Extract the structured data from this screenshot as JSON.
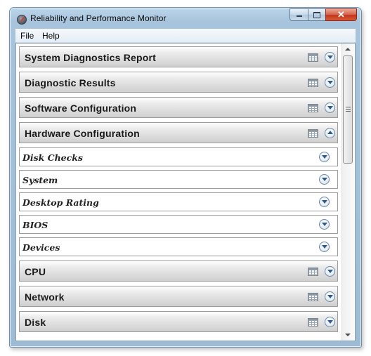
{
  "window": {
    "title": "Reliability and Performance Monitor",
    "close_glyph": "✕"
  },
  "menu": {
    "file": "File",
    "help": "Help"
  },
  "rows": [
    {
      "label": "System Diagnostics Report",
      "kind": "section",
      "expanded": false
    },
    {
      "label": "Diagnostic Results",
      "kind": "section",
      "expanded": false
    },
    {
      "label": "Software Configuration",
      "kind": "section",
      "expanded": false
    },
    {
      "label": "Hardware Configuration",
      "kind": "section",
      "expanded": true
    },
    {
      "label": "Disk Checks",
      "kind": "subsection",
      "expanded": false
    },
    {
      "label": "System",
      "kind": "subsection",
      "expanded": false
    },
    {
      "label": "Desktop Rating",
      "kind": "subsection",
      "expanded": false
    },
    {
      "label": "BIOS",
      "kind": "subsection",
      "expanded": false
    },
    {
      "label": "Devices",
      "kind": "subsection",
      "expanded": false
    },
    {
      "label": "CPU",
      "kind": "section",
      "expanded": false
    },
    {
      "label": "Network",
      "kind": "section",
      "expanded": false
    },
    {
      "label": "Disk",
      "kind": "section",
      "expanded": false
    }
  ],
  "icons": {
    "app": "performance-monitor-icon",
    "table": "table-view-icon",
    "expand": "expand-chevron-icon",
    "collapse": "collapse-chevron-icon"
  }
}
